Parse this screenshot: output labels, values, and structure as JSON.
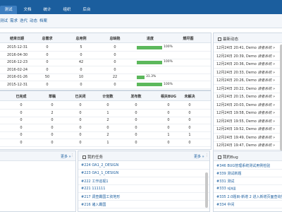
{
  "nav": {
    "tabs": [
      "测试",
      "文档",
      "统计",
      "组织",
      "后台"
    ]
  },
  "subnav": {
    "items": [
      "测试",
      "需求",
      "迭代",
      "动态",
      "档案"
    ]
  },
  "stats": {
    "headers": [
      "结束日期",
      "总需求",
      "总用例",
      "总缺陷",
      "进度",
      "燃尽图"
    ],
    "rows": [
      {
        "date": "2015-12-31",
        "a": "0",
        "b": "5",
        "c": "0",
        "progress": 100,
        "label": "100%"
      },
      {
        "date": "2016-04-30",
        "a": "0",
        "b": "0",
        "c": "0",
        "progress": 0,
        "label": ""
      },
      {
        "date": "2016-12-23",
        "a": "0",
        "b": "42",
        "c": "0",
        "progress": 100,
        "label": "100%"
      },
      {
        "date": "2016-02-24",
        "a": "0",
        "b": "0",
        "c": "0",
        "progress": 0,
        "label": ""
      },
      {
        "date": "2016-01-26",
        "a": "50",
        "b": "10",
        "c": "22",
        "progress": 31.3,
        "label": "31.3%"
      },
      {
        "date": "2015-12-31",
        "a": "0",
        "b": "0",
        "c": "0",
        "progress": 100,
        "label": "100%"
      }
    ]
  },
  "dynamics": {
    "title": "最新动态",
    "rows": [
      {
        "time": "12月24日 20:41,",
        "who": "Demo",
        "act": "读者系统 »"
      },
      {
        "time": "12月24日 20:39,",
        "who": "Demo",
        "act": "读者系统 »"
      },
      {
        "time": "12月24日 20:36,",
        "who": "Demo",
        "act": "读者系统 »"
      },
      {
        "time": "12月24日 20:33,",
        "who": "Demo",
        "act": "读者系统 »"
      },
      {
        "time": "12月24日 20:26,",
        "who": "Demo",
        "act": "读者系统 »"
      },
      {
        "time": "12月24日 20:22,",
        "who": "Demo",
        "act": "读者系统 »"
      },
      {
        "time": "12月24日 20:15,",
        "who": "Demo",
        "act": "读者系统 »"
      },
      {
        "time": "12月24日 20:03,",
        "who": "Demo",
        "act": "读者系统 »"
      },
      {
        "time": "12月24日 19:58,",
        "who": "Demo",
        "act": "读者系统 »"
      },
      {
        "time": "12月24日 19:55,",
        "who": "Demo",
        "act": "读者系统 »"
      },
      {
        "time": "12月24日 19:52,",
        "who": "Demo",
        "act": "读者系统 »"
      },
      {
        "time": "12月24日 19:49,",
        "who": "Demo",
        "act": "读者系统 »"
      },
      {
        "time": "12月24日 19:47,",
        "who": "Demo",
        "act": "读者系统 »"
      }
    ]
  },
  "bugs_table": {
    "headers": [
      "已完成",
      "草稿",
      "已关闭",
      "计划数",
      "发布数",
      "相关BUG",
      "未解决"
    ],
    "rows": [
      [
        "0",
        "0",
        "0",
        "0",
        "0",
        "0",
        "0"
      ],
      [
        "0",
        "2",
        "0",
        "1",
        "0",
        "0",
        "0"
      ],
      [
        "0",
        "0",
        "0",
        "2",
        "0",
        "0",
        "0"
      ],
      [
        "0",
        "0",
        "0",
        "0",
        "0",
        "0",
        "0"
      ],
      [
        "0",
        "0",
        "0",
        "2",
        "0",
        "1",
        "1"
      ],
      [
        "0",
        "0",
        "0",
        "1",
        "0",
        "0",
        "0"
      ]
    ]
  },
  "left_bottom": {
    "more": "更多 »"
  },
  "tasks": {
    "title": "我的任务",
    "more": "更多 »",
    "items": [
      "#224 OA1_2_DESIGN",
      "#223 OA1_1_DESIGN",
      "#222 工作巡视1",
      "#221 111111",
      "#217 调查霸国工资地形",
      "#216 诸入霸国"
    ]
  },
  "mybugs": {
    "title": "我的Bug",
    "items": [
      "#346 BUG管理系统测试用例检验",
      "#339 测试新题",
      "#331 测试",
      "#333 sjjsjjj",
      "#335 2.0题目-新增 2 进入新增页面查询界面",
      "#334 中间"
    ]
  }
}
